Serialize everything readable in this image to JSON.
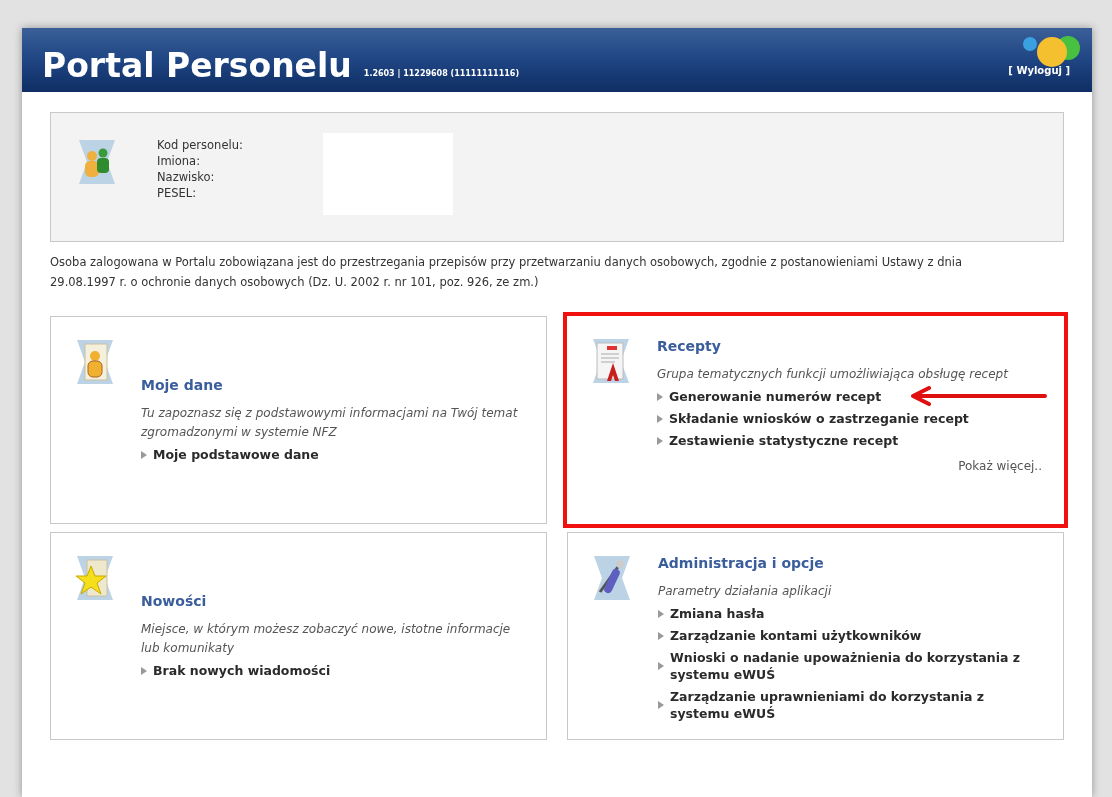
{
  "header": {
    "title": "Portal Personelu",
    "version": "1.2603 | 11229608 (11111111116)",
    "logout": "[ Wyloguj ]"
  },
  "profile": {
    "labels": [
      "Kod personelu:",
      "Imiona:",
      "Nazwisko:",
      "PESEL:"
    ]
  },
  "notice": "Osoba zalogowana w Portalu zobowiązana jest do przestrzegania przepisów przy przetwarzaniu danych osobowych, zgodnie z postanowieniami Ustawy z dnia 29.08.1997 r. o ochronie danych osobowych (Dz. U. 2002 r. nr 101, poz. 926, ze zm.)",
  "cards": [
    {
      "kind": "data",
      "title": "Moje dane",
      "description": "Tu zapoznasz się z podstawowymi informacjami na Twój temat zgromadzonymi w systemie NFZ",
      "highlighted": false,
      "links": [
        {
          "label": "Moje podstawowe dane",
          "pointed": false
        }
      ]
    },
    {
      "kind": "prescriptions",
      "title": "Recepty",
      "description": "Grupa tematycznych funkcji umożliwiająca obsługę recept",
      "highlighted": true,
      "links": [
        {
          "label": "Generowanie numerów recept",
          "pointed": true
        },
        {
          "label": "Składanie wniosków o zastrzeganie recept",
          "pointed": false
        },
        {
          "label": "Zestawienie statystyczne recept",
          "pointed": false
        }
      ],
      "more": "Pokaż więcej.."
    },
    {
      "kind": "news",
      "title": "Nowości",
      "description": "Miejsce, w którym możesz zobaczyć nowe, istotne informacje lub komunikaty",
      "highlighted": false,
      "links": [
        {
          "label": "Brak nowych wiadomości",
          "pointed": false
        }
      ]
    },
    {
      "kind": "admin",
      "title": "Administracja i opcje",
      "description": "Parametry działania aplikacji",
      "highlighted": false,
      "links": [
        {
          "label": "Zmiana hasła",
          "pointed": false
        },
        {
          "label": "Zarządzanie kontami użytkowników",
          "pointed": false
        },
        {
          "label": "Wnioski o nadanie upoważnienia do korzystania z systemu eWUŚ",
          "pointed": false
        },
        {
          "label": "Zarządzanie uprawnieniami do korzystania z systemu eWUŚ",
          "pointed": false
        }
      ]
    }
  ]
}
